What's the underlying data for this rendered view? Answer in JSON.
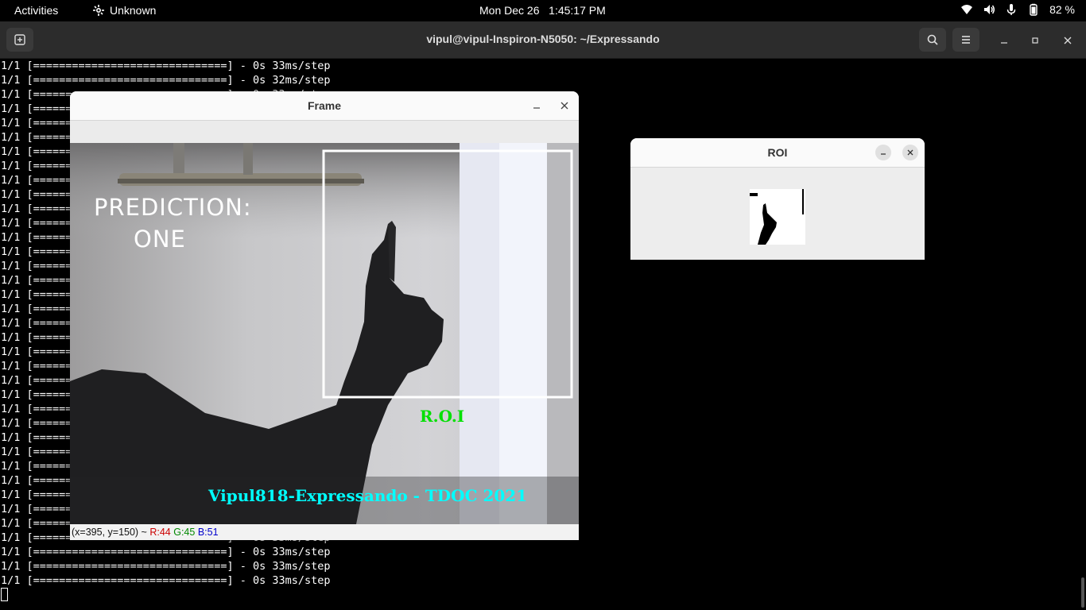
{
  "topbar": {
    "activities": "Activities",
    "app_indicator": "Unknown",
    "clock": "Mon Dec 26   1:45:17 PM",
    "battery": "82 %",
    "icons": [
      "network-icon",
      "volume-icon",
      "microphone-icon",
      "battery-icon"
    ]
  },
  "terminal": {
    "title": "vipul@vipul-Inspiron-N5050: ~/Expressando",
    "lines": [
      "1/1 [==============================] - 0s 33ms/step",
      "1/1 [==============================] - 0s 32ms/step",
      "1/1 [==============================] - 0s 33ms/step",
      "1/1 [==============================] - 0s 33ms/step",
      "1/1 [==============================] - 0s 33ms/step",
      "1/1 [==============================] - 0s 33ms/step",
      "1/1 [==============================] - 0s 33ms/step",
      "1/1 [==============================] - 0s 33ms/step",
      "1/1 [==============================] - 0s 33ms/step",
      "1/1 [==============================] - 0s 33ms/step",
      "1/1 [==============================] - 0s 33ms/step",
      "1/1 [==============================] - 0s 33ms/step",
      "1/1 [==============================] - 0s 33ms/step",
      "1/1 [==============================] - 0s 33ms/step",
      "1/1 [==============================] - 0s 33ms/step",
      "1/1 [==============================] - 0s 33ms/step",
      "1/1 [==============================] - 0s 33ms/step",
      "1/1 [==============================] - 0s 33ms/step",
      "1/1 [==============================] - 0s 33ms/step",
      "1/1 [==============================] - 0s 33ms/step",
      "1/1 [==============================] - 0s 33ms/step",
      "1/1 [==============================] - 0s 33ms/step",
      "1/1 [==============================] - 0s 33ms/step",
      "1/1 [==============================] - 0s 33ms/step",
      "1/1 [==============================] - 0s 33ms/step",
      "1/1 [==============================] - 0s 33ms/step",
      "1/1 [==============================] - 0s 33ms/step",
      "1/1 [==============================] - 0s 33ms/step",
      "1/1 [==============================] - 0s 33ms/step",
      "1/1 [==============================] - 0s 33ms/step",
      "1/1 [==============================] - 0s 33ms/step",
      "1/1 [==============================] - 0s 33ms/step",
      "1/1 [==============================] - 0s 33ms/step",
      "1/1 [==============================] - 0s 33ms/step",
      "1/1 [==============================] - 0s 33ms/step",
      "1/1 [==============================] - 0s 33ms/step",
      "1/1 [==============================] - 0s 33ms/step"
    ]
  },
  "frame_window": {
    "title": "Frame",
    "prediction_label": "PREDICTION:",
    "prediction_value": "ONE",
    "roi_label": "R.O.I",
    "credit": "Vipul818-Expressando - TDOC 2021",
    "status": {
      "coords": "(x=395, y=150) ~",
      "r": "R:44",
      "g": "G:45",
      "b": "B:51"
    }
  },
  "roi_window": {
    "title": "ROI"
  },
  "colors": {
    "roi_text": "#00e000",
    "credit_text": "#00ffff",
    "status_r": "#cc0000",
    "status_g": "#008800",
    "status_b": "#0000cc"
  }
}
